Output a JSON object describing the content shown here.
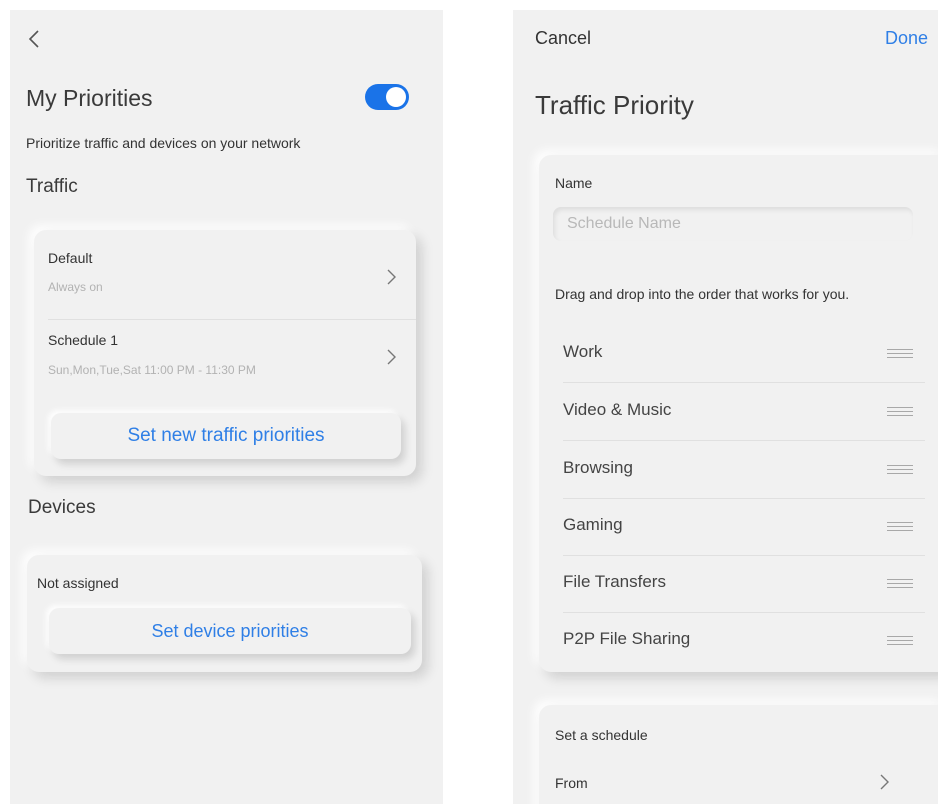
{
  "priorities_screen": {
    "title": "My Priorities",
    "toggle_on": true,
    "subtitle": "Prioritize traffic and devices on your network",
    "traffic_heading": "Traffic",
    "traffic_items": [
      {
        "title": "Default",
        "subtitle": "Always on"
      },
      {
        "title": "Schedule 1",
        "subtitle": "Sun,Mon,Tue,Sat 11:00 PM - 11:30 PM"
      }
    ],
    "traffic_button": "Set new traffic priorities",
    "devices_heading": "Devices",
    "devices_status": "Not assigned",
    "devices_button": "Set device priorities",
    "icons": [
      "back-arrow-icon",
      "chevron-right-icon"
    ]
  },
  "traffic_priority_screen": {
    "cancel_label": "Cancel",
    "done_label": "Done",
    "title": "Traffic Priority",
    "name_label": "Name",
    "name_placeholder": "Schedule Name",
    "instructions": "Drag and drop into the order that works for you.",
    "categories": [
      "Work",
      "Video & Music",
      "Browsing",
      "Gaming",
      "File Transfers",
      "P2P File Sharing"
    ],
    "schedule_heading": "Set a schedule",
    "from_label": "From",
    "icons": [
      "drag-handle-icon",
      "chevron-right-icon"
    ]
  },
  "colors": {
    "accent": "#1a73e8",
    "link": "#2f7fe6",
    "background": "#f1f1f1",
    "muted_text": "#b2b2b2"
  }
}
